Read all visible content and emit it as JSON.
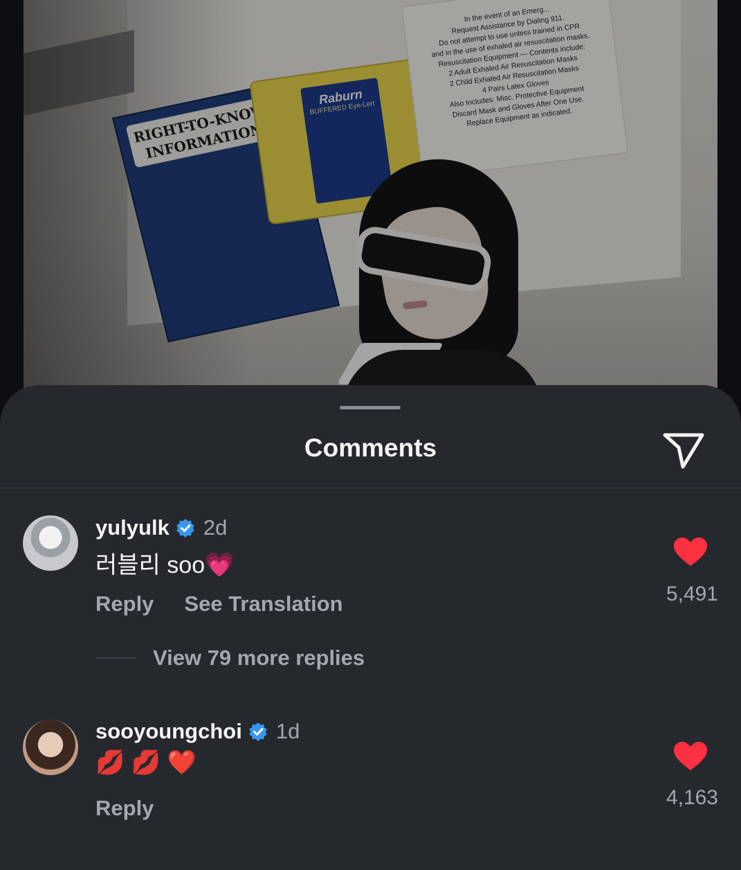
{
  "post": {
    "poster_title": "RIGHT-TO-KNOW INFORMATION",
    "eyewash_brand": "Raburn",
    "eyewash_subtitle": "BUFFERED Eye-Lert",
    "notice_lines": [
      "In the event of an Emerg...",
      "Request Assistance by Dialing 911.",
      "Do not attempt to use unless trained in CPR",
      "and in the use of exhaled air resuscitation masks.",
      "Resuscitation Equipment — Contents include:",
      "2 Adult Exhaled Air Resuscitation Masks",
      "2 Child Exhaled Air Resuscitation Masks",
      "4 Pairs Latex Gloves",
      "Also Includes: Misc. Protective Equipment",
      "Discard Mask and Gloves After One Use.",
      "Replace Equipment as indicated."
    ]
  },
  "sheet": {
    "title": "Comments",
    "share_icon": "paper-plane-icon"
  },
  "comments": [
    {
      "username": "yulyulk",
      "verified": true,
      "time": "2d",
      "text": "러블리 soo💗",
      "actions": [
        "Reply",
        "See Translation"
      ],
      "likes": "5,491",
      "view_replies": "View 79 more replies"
    },
    {
      "username": "sooyoungchoi",
      "verified": true,
      "time": "1d",
      "text": "💋 💋 ❤️",
      "actions": [
        "Reply"
      ],
      "likes": "4,163"
    }
  ],
  "colors": {
    "sheet_bg": "#25292e",
    "text_primary": "#f4f4f4",
    "text_secondary": "#a3a8ae",
    "verified_blue": "#3797f0",
    "like_red": "#ff3040"
  }
}
